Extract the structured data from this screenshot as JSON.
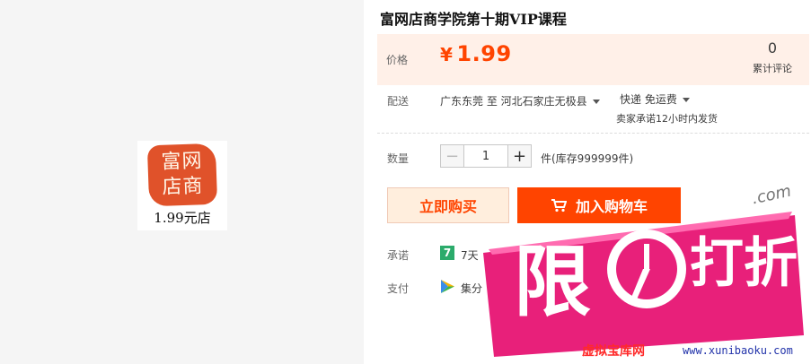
{
  "product": {
    "title": "富网店商学院第十期VIP课程",
    "logo_seal_line1": "富网",
    "logo_seal_line2": "店商",
    "logo_caption": "1.99元店"
  },
  "price": {
    "label": "价格",
    "currency": "¥",
    "value": "1.99",
    "review_count": "0",
    "review_label": "累计评论"
  },
  "shipping": {
    "label": "配送",
    "route": "广东东莞 至  河北石家庄无极县",
    "method": "快递 免运费",
    "promise": "卖家承诺12小时内发货"
  },
  "quantity": {
    "label": "数量",
    "value": "1",
    "minus": "−",
    "plus": "+",
    "stock": "件(库存999999件)"
  },
  "actions": {
    "buy_now": "立即购买",
    "add_to_cart": "加入购物车"
  },
  "promise": {
    "label": "承诺",
    "badge": "7",
    "text": "7天"
  },
  "payment": {
    "label": "支付",
    "text": "集分"
  },
  "promo": {
    "left_char": "限",
    "right_chars": "打折",
    "watermark": ".com",
    "site_name": "虚拟宝库网",
    "site_url": "www.xunibaoku.com"
  },
  "colors": {
    "accent": "#ff4400",
    "price_bar_bg": "#fff0e8",
    "promo_pink": "#e8207a",
    "seal_red": "#e0522a"
  }
}
